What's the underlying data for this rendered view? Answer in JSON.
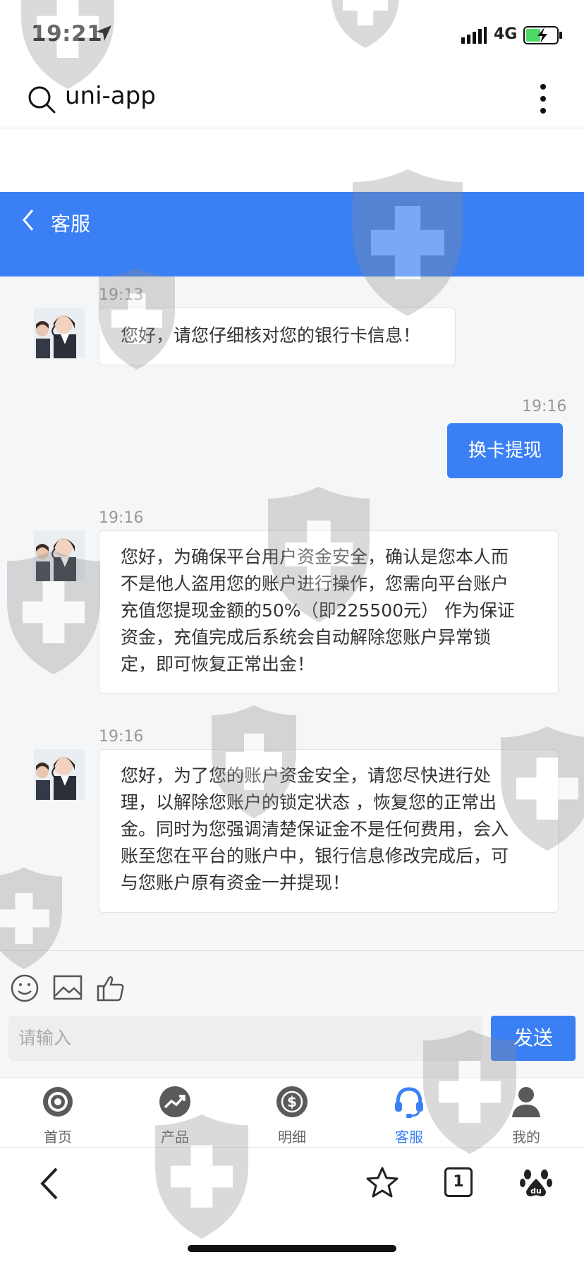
{
  "status_bar": {
    "time": "19:21",
    "network": "4G"
  },
  "browser": {
    "title": "uni-app"
  },
  "header": {
    "title": "客服"
  },
  "messages": [
    {
      "side": "left",
      "time": "19:13",
      "lines": [
        "您好，请您仔细核对您的银行卡信息！"
      ]
    },
    {
      "side": "right",
      "time": "19:16",
      "text": "换卡提现"
    },
    {
      "side": "left",
      "time": "19:16",
      "lines": [
        "您好，为确保平台用户资金安全，确认是您本人而",
        "不是他人盗用您的账户进行操作，您需向平台账户",
        "充值您提现金额的50%（即225500元） 作为保证",
        "资金，充值完成后系统会自动解除您账户异常锁",
        "定，即可恢复正常出金！"
      ]
    },
    {
      "side": "left",
      "time": "19:16",
      "lines": [
        "您好，为了您的账户资金安全，请您尽快进行处",
        "理，以解除您账户的锁定状态 ，恢复您的正常出",
        "金。同时为您强调清楚保证金不是任何费用，会入",
        "账至您在平台的账户中，银行信息修改完成后，可",
        "与您账户原有资金一并提现！"
      ]
    }
  ],
  "input": {
    "placeholder": "请输入",
    "send_label": "发送"
  },
  "tabs": [
    {
      "label": "首页",
      "icon": "home-target-icon",
      "active": false
    },
    {
      "label": "产品",
      "icon": "trend-chart-icon",
      "active": false
    },
    {
      "label": "明细",
      "icon": "dollar-coin-icon",
      "active": false
    },
    {
      "label": "客服",
      "icon": "headset-icon",
      "active": true
    },
    {
      "label": "我的",
      "icon": "user-icon",
      "active": false
    }
  ],
  "browser_nav": {
    "tab_count": "1"
  },
  "colors": {
    "accent": "#3a80f4",
    "chat_bg": "#f5f6f8"
  }
}
